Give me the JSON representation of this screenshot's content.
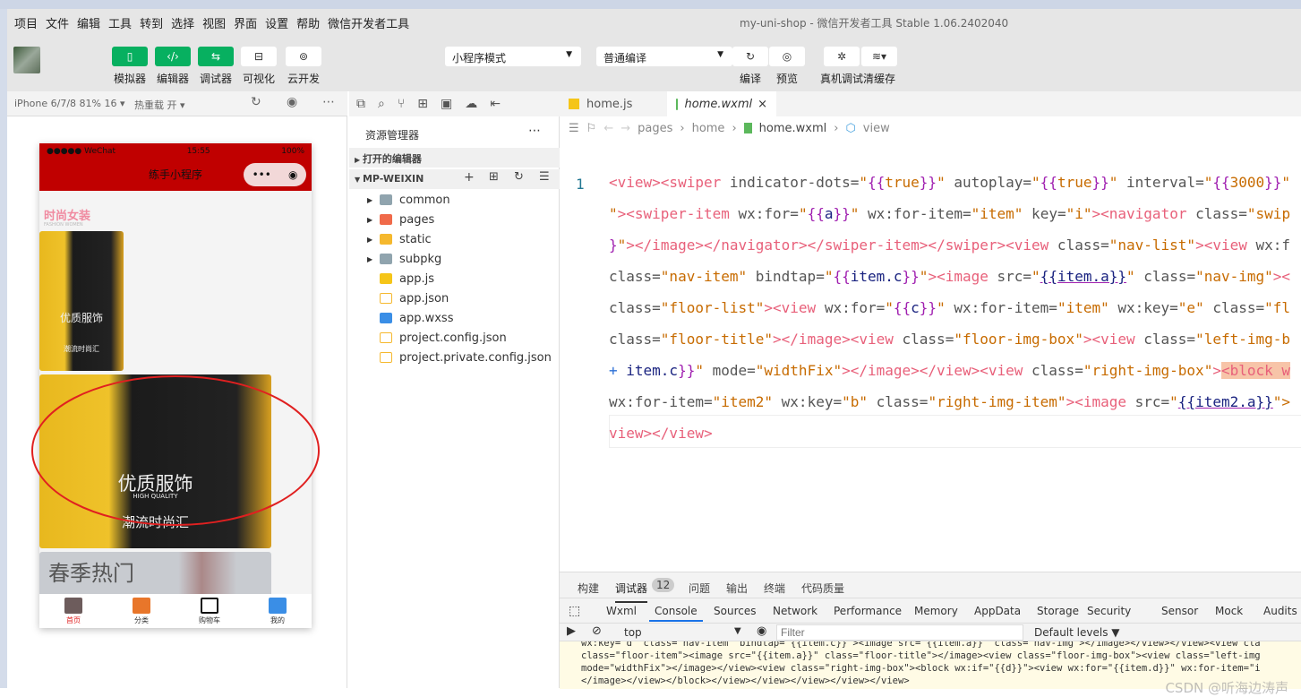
{
  "window": {
    "title": "my-uni-shop - 微信开发者工具 Stable 1.06.2402040"
  },
  "menu": [
    "项目",
    "文件",
    "编辑",
    "工具",
    "转到",
    "选择",
    "视图",
    "界面",
    "设置",
    "帮助",
    "微信开发者工具"
  ],
  "toolbar": {
    "left_buttons": [
      {
        "label": "模拟器",
        "icon": "phone-icon"
      },
      {
        "label": "编辑器",
        "icon": "code-icon"
      },
      {
        "label": "调试器",
        "icon": "debug-sliders-icon"
      },
      {
        "label": "可视化",
        "icon": "layout-icon"
      },
      {
        "label": "云开发",
        "icon": "cloud-icon"
      }
    ],
    "mode_select": "小程序模式",
    "compile_select": "普通编译",
    "right_buttons": [
      {
        "label": "编译",
        "icon": "refresh-icon"
      },
      {
        "label": "预览",
        "icon": "eye-icon"
      },
      {
        "label": "真机调试",
        "icon": "bug-icon"
      },
      {
        "label": "清缓存",
        "icon": "layers-icon"
      }
    ]
  },
  "simulator": {
    "device": "iPhone 6/7/8 81% 16 ▾",
    "hot_reload": "热重载 开 ▾",
    "status": {
      "carrier": "●●●●● WeChat",
      "time": "15:55",
      "battery": "100%"
    },
    "nav_title": "练手小程序",
    "capsule_dots": "•••",
    "floor_title": "时尚女装",
    "floor_sub": "FASHION WOMEN",
    "img_text": "优质服饰",
    "img_sub": "HIGH QUALITY",
    "img_text2": "潮流时尚汇",
    "spring": "春季热门",
    "tabs": [
      {
        "label": "首页",
        "active": true
      },
      {
        "label": "分类"
      },
      {
        "label": "购物车"
      },
      {
        "label": "我的"
      }
    ],
    "accent": "#c00000",
    "annotation_color": "#e02020"
  },
  "explorer": {
    "title": "资源管理器",
    "open_editors": "打开的编辑器",
    "project": "MP-WEIXIN",
    "items": [
      {
        "name": "common",
        "type": "folder",
        "color": "#90a4ae"
      },
      {
        "name": "pages",
        "type": "folder",
        "color": "#f06a4a"
      },
      {
        "name": "static",
        "type": "folder",
        "color": "#f5b82e"
      },
      {
        "name": "subpkg",
        "type": "folder",
        "color": "#90a4ae"
      },
      {
        "name": "app.js",
        "type": "js",
        "color": "#f5c518"
      },
      {
        "name": "app.json",
        "type": "json",
        "color": "#f5b82e"
      },
      {
        "name": "app.wxss",
        "type": "css",
        "color": "#3a8ee6"
      },
      {
        "name": "project.config.json",
        "type": "json",
        "color": "#f5b82e"
      },
      {
        "name": "project.private.config.json",
        "type": "json",
        "color": "#f5b82e"
      }
    ]
  },
  "editor": {
    "tabs": [
      {
        "label": "home.js",
        "active": false
      },
      {
        "label": "home.wxml",
        "active": true
      }
    ],
    "breadcrumb": [
      "pages",
      "home",
      "home.wxml",
      "view"
    ],
    "line_number": "1",
    "lines": [
      [
        [
          "t",
          "<view><swiper"
        ],
        [
          "a",
          " indicator-dots="
        ],
        [
          "s",
          "\""
        ],
        [
          "m",
          "{{"
        ],
        [
          "s",
          "true"
        ],
        [
          "m",
          "}}"
        ],
        [
          "s",
          "\""
        ],
        [
          "a",
          " autoplay="
        ],
        [
          "s",
          "\""
        ],
        [
          "m",
          "{{"
        ],
        [
          "s",
          "true"
        ],
        [
          "m",
          "}}"
        ],
        [
          "s",
          "\""
        ],
        [
          "a",
          " interval="
        ],
        [
          "s",
          "\""
        ],
        [
          "m",
          "{{"
        ],
        [
          "s",
          "3000"
        ],
        [
          "m",
          "}}"
        ],
        [
          "s",
          "\""
        ]
      ],
      [
        [
          "s",
          "\""
        ],
        [
          "t",
          "><swiper-item"
        ],
        [
          "a",
          " wx:for="
        ],
        [
          "s",
          "\""
        ],
        [
          "m",
          "{{"
        ],
        [
          "v",
          "a"
        ],
        [
          "m",
          "}}"
        ],
        [
          "s",
          "\""
        ],
        [
          "a",
          " wx:for-item="
        ],
        [
          "s",
          "\"item\""
        ],
        [
          "a",
          " key="
        ],
        [
          "s",
          "\"i\""
        ],
        [
          "t",
          "><navigator"
        ],
        [
          "a",
          " class="
        ],
        [
          "s",
          "\"swip"
        ]
      ],
      [
        [
          "m",
          "}"
        ],
        [
          "s",
          "\""
        ],
        [
          "t",
          "></image></navigator></swiper-item></swiper><view"
        ],
        [
          "a",
          " class="
        ],
        [
          "s",
          "\"nav-list\""
        ],
        [
          "t",
          "><view"
        ],
        [
          "a",
          " wx:f"
        ]
      ],
      [
        [
          "a",
          "class="
        ],
        [
          "s",
          "\"nav-item\""
        ],
        [
          "a",
          " bindtap="
        ],
        [
          "s",
          "\""
        ],
        [
          "m",
          "{{"
        ],
        [
          "v",
          "item.c"
        ],
        [
          "m",
          "}}"
        ],
        [
          "s",
          "\""
        ],
        [
          "t",
          "><image"
        ],
        [
          "a",
          " src="
        ],
        [
          "s",
          "\""
        ],
        [
          "u",
          "{{item.a}}"
        ],
        [
          "s",
          "\""
        ],
        [
          "a",
          " class="
        ],
        [
          "s",
          "\"nav-img\""
        ],
        [
          "t",
          "><"
        ]
      ],
      [
        [
          "a",
          "class="
        ],
        [
          "s",
          "\"floor-list\""
        ],
        [
          "t",
          "><view"
        ],
        [
          "a",
          " wx:for="
        ],
        [
          "s",
          "\""
        ],
        [
          "m",
          "{{"
        ],
        [
          "v",
          "c"
        ],
        [
          "m",
          "}}"
        ],
        [
          "s",
          "\""
        ],
        [
          "a",
          " wx:for-item="
        ],
        [
          "s",
          "\"item\""
        ],
        [
          "a",
          " wx:key="
        ],
        [
          "s",
          "\"e\""
        ],
        [
          "a",
          " class="
        ],
        [
          "s",
          "\"fl"
        ]
      ],
      [
        [
          "a",
          "class="
        ],
        [
          "s",
          "\"floor-title\""
        ],
        [
          "t",
          "></image><view"
        ],
        [
          "a",
          " class="
        ],
        [
          "s",
          "\"floor-img-box\""
        ],
        [
          "t",
          "><view"
        ],
        [
          "a",
          " class="
        ],
        [
          "s",
          "\"left-img-b"
        ]
      ],
      [
        [
          "b",
          "+ "
        ],
        [
          "v",
          "item.c"
        ],
        [
          "m",
          "}}"
        ],
        [
          "s",
          "\""
        ],
        [
          "a",
          " mode="
        ],
        [
          "s",
          "\"widthFix\""
        ],
        [
          "t",
          "></image></view><view"
        ],
        [
          "a",
          " class="
        ],
        [
          "s",
          "\"right-img-box\""
        ],
        [
          "t",
          ">"
        ],
        [
          "h",
          "<block w"
        ]
      ],
      [
        [
          "a",
          "wx:for-item="
        ],
        [
          "s",
          "\"item2\""
        ],
        [
          "a",
          " wx:key="
        ],
        [
          "s",
          "\"b\""
        ],
        [
          "a",
          " class="
        ],
        [
          "s",
          "\"right-img-item\""
        ],
        [
          "t",
          "><image"
        ],
        [
          "a",
          " src="
        ],
        [
          "s",
          "\""
        ],
        [
          "u",
          "{{item2.a}}"
        ],
        [
          "s",
          "\">"
        ]
      ],
      [
        [
          "t",
          "view></view>"
        ]
      ]
    ]
  },
  "bottom_panel": {
    "tabs": [
      "构建",
      "调试器",
      "问题",
      "输出",
      "终端",
      "代码质量"
    ],
    "debugger_badge": "12",
    "devtools_tabs": [
      "Wxml",
      "Console",
      "Sources",
      "Network",
      "Performance",
      "Memory",
      "AppData",
      "Storage",
      "Security",
      "Sensor",
      "Mock",
      "Audits"
    ],
    "active_devtool": "Console",
    "context": "top",
    "filter_placeholder": "Filter",
    "levels": "Default levels ▼",
    "console_lines": [
      "wx:key=\"d\" class=\"nav-item\" bindtap=\"{{item.c}}\"><image src=\"{{item.a}}\" class=\"nav-img\"></image></view></view><view cla",
      "class=\"floor-item\"><image src=\"{{item.a}}\" class=\"floor-title\"></image><view class=\"floor-img-box\"><view class=\"left-img",
      "mode=\"widthFix\"></image></view><view class=\"right-img-box\"><block wx:if=\"{{d}}\"><view wx:for=\"{{item.d}}\" wx:for-item=\"i",
      "</image></view></block></view></view></view></view></view>"
    ],
    "watermark": "CSDN @听海边涛声"
  }
}
